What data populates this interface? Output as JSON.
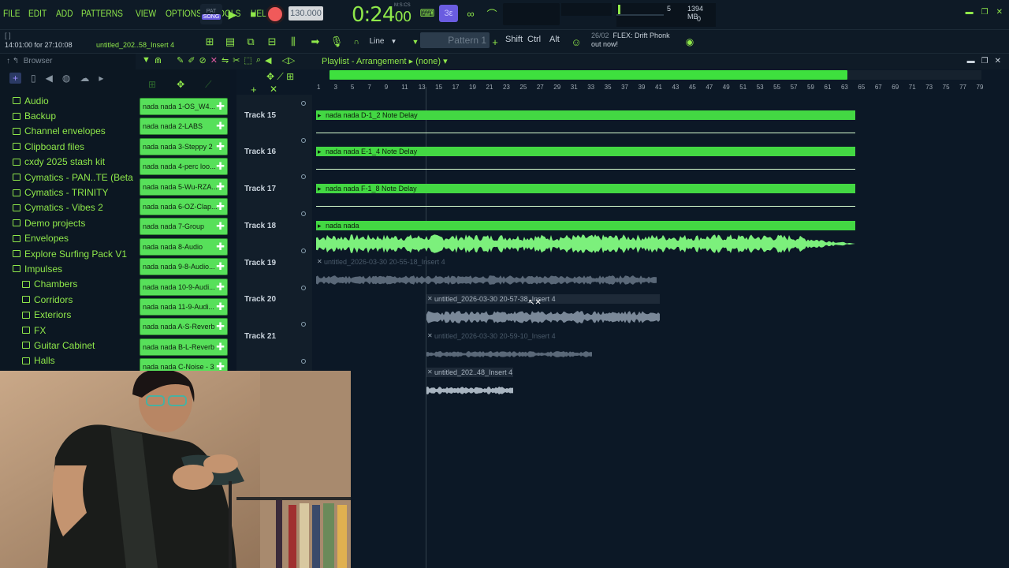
{
  "menu": [
    "FILE",
    "EDIT",
    "ADD",
    "PATTERNS",
    "VIEW",
    "OPTIONS",
    "TOOLS",
    "HELP"
  ],
  "transport": {
    "pat_label": "PAT",
    "song_label": "SONG",
    "tempo": "130.000",
    "time_main": "0:24",
    "time_sub": "00",
    "time_caption": "M:S:CS",
    "cpu_value": "5",
    "memory": "1394 MB",
    "poly": "0"
  },
  "hint_bar": {
    "line1": "[ ]",
    "position": "14:01:00 for 27:10:08",
    "project": "untitled_202..58_Insert 4",
    "snap": "Line",
    "pattern": "Pattern 1",
    "keys": [
      "Shift",
      "Ctrl",
      "Alt"
    ],
    "news_date": "26/02",
    "news_title": "FLEX: Drift Phonk",
    "news_msg": "out now!"
  },
  "browser": {
    "title": "Browser",
    "items": [
      {
        "label": "Audio",
        "sub": false
      },
      {
        "label": "Backup",
        "sub": false
      },
      {
        "label": "Channel envelopes",
        "sub": false
      },
      {
        "label": "Clipboard files",
        "sub": false
      },
      {
        "label": "cxdy 2025 stash kit",
        "sub": false
      },
      {
        "label": "Cymatics - PAN..TE (Beta Pack)",
        "sub": false
      },
      {
        "label": "Cymatics - TRINITY",
        "sub": false
      },
      {
        "label": "Cymatics - Vibes 2",
        "sub": false
      },
      {
        "label": "Demo projects",
        "sub": false
      },
      {
        "label": "Envelopes",
        "sub": false
      },
      {
        "label": "Explore Surfing Pack V1",
        "sub": false
      },
      {
        "label": "Impulses",
        "sub": false
      },
      {
        "label": "Chambers",
        "sub": true
      },
      {
        "label": "Corridors",
        "sub": true
      },
      {
        "label": "Exteriors",
        "sub": true
      },
      {
        "label": "FX",
        "sub": true
      },
      {
        "label": "Guitar Cabinet",
        "sub": true
      },
      {
        "label": "Halls",
        "sub": true
      }
    ]
  },
  "channels": [
    "nada nada 1-OS_W4...",
    "nada nada 2-LABS",
    "nada nada 3-Steppy 2",
    "nada nada 4-perc loo...",
    "nada nada 5-Wu-RZA...",
    "nada nada 6-OZ-Clap...",
    "nada nada 7-Group",
    "nada nada 8-Audio",
    "nada nada 9-8-Audio...",
    "nada nada 10-9-Audi...",
    "nada nada 11-9-Audi...",
    "nada nada A-S-Reverb",
    "nada nada B-L-Reverb",
    "nada nada C-Noise - 3"
  ],
  "playlist": {
    "title": "Playlist - Arrangement",
    "arrangement": "(none)",
    "ruler": [
      "1",
      "3",
      "5",
      "7",
      "9",
      "11",
      "13",
      "15",
      "17",
      "19",
      "21",
      "23",
      "25",
      "27",
      "29",
      "31",
      "33",
      "35",
      "37",
      "39",
      "41",
      "43",
      "45",
      "47",
      "49",
      "51",
      "53",
      "55",
      "57",
      "59",
      "61",
      "63",
      "65",
      "67",
      "69",
      "71",
      "73",
      "75",
      "77",
      "79"
    ],
    "tracks": [
      "Track 15",
      "Track 16",
      "Track 17",
      "Track 18",
      "Track 19",
      "Track 20",
      "Track 21"
    ],
    "clips": {
      "t15": "nada nada D-1_2 Note Delay",
      "t16": "nada nada E-1_4 Note Delay",
      "t17": "nada nada F-1_8 Note Delay",
      "t18": "nada nada",
      "t19": "untitled_2026-03-30 20-55-18_Insert 4",
      "t20": "untitled_2026-03-30 20-57-38_Insert 4",
      "t21": "untitled_2026-03-30 20-59-10_Insert 4",
      "t22": "untitled_202..48_Insert 4"
    }
  },
  "colors": {
    "accent_green": "#8fe84a",
    "clip_green": "#43d843",
    "record_red": "#f05a5a",
    "purple": "#6a5ce0",
    "background": "#0b1624"
  }
}
